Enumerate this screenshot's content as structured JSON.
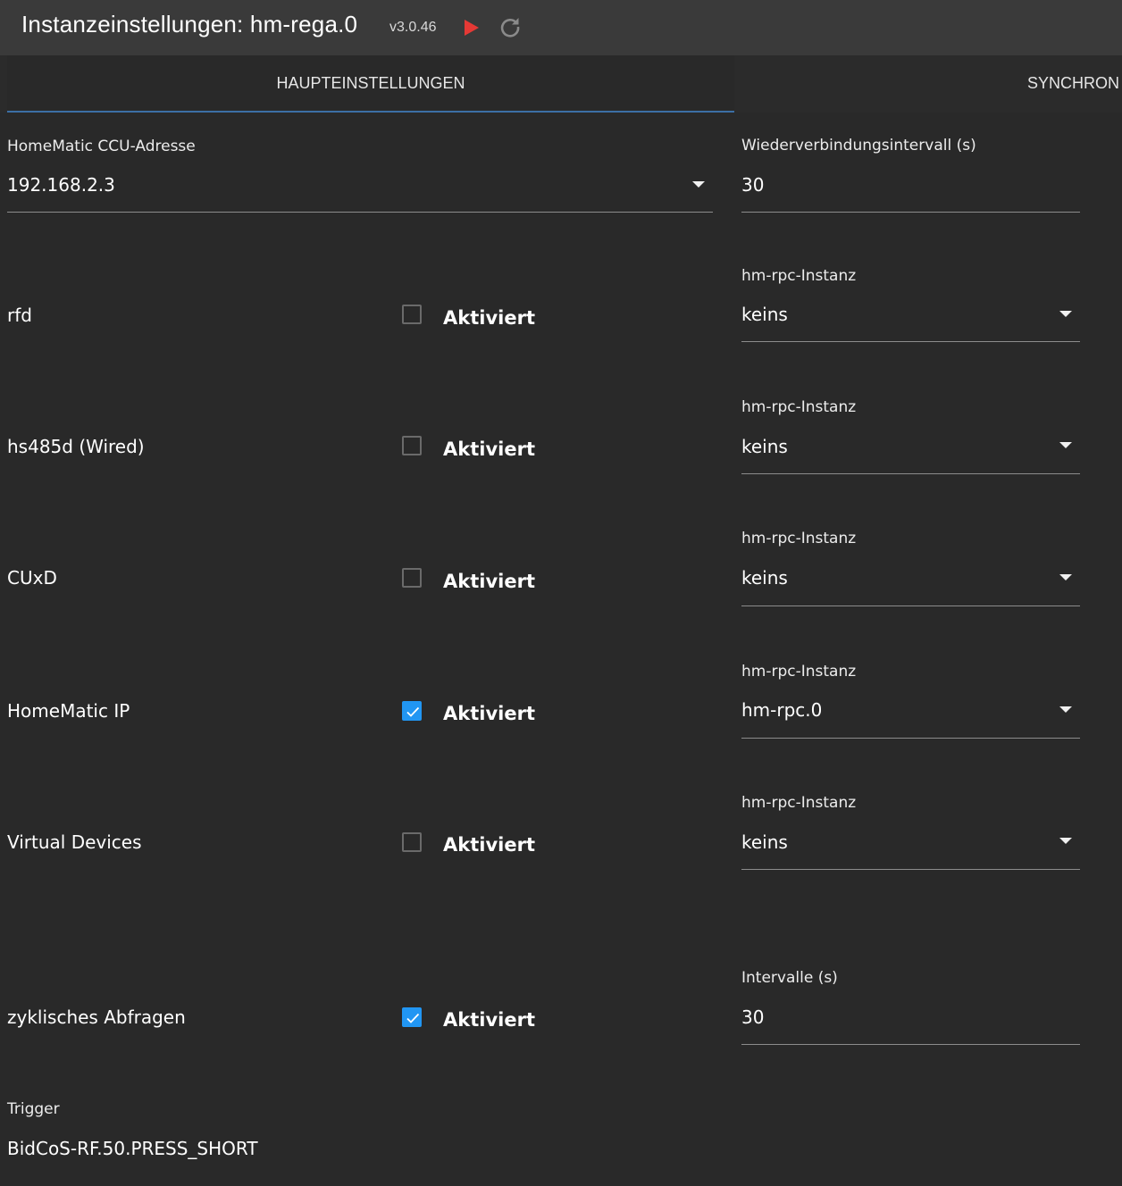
{
  "header": {
    "title": "Instanzeinstellungen: hm-rega.0",
    "version": "v3.0.46"
  },
  "tabs": [
    {
      "label": "HAUPTEINSTELLUNGEN"
    },
    {
      "label": "SYNCHRON"
    }
  ],
  "ccu": {
    "label": "HomeMatic CCU-Adresse",
    "value": "192.168.2.3"
  },
  "reconnect": {
    "label": "Wiederverbindungsintervall (s)",
    "value": "30"
  },
  "rows": [
    {
      "name": "rfd",
      "checkbox_label": "Aktiviert",
      "checked": false,
      "instance_label": "hm-rpc-Instanz",
      "instance_value": "keins"
    },
    {
      "name": "hs485d (Wired)",
      "checkbox_label": "Aktiviert",
      "checked": false,
      "instance_label": "hm-rpc-Instanz",
      "instance_value": "keins"
    },
    {
      "name": "CUxD",
      "checkbox_label": "Aktiviert",
      "checked": false,
      "instance_label": "hm-rpc-Instanz",
      "instance_value": "keins"
    },
    {
      "name": "HomeMatic IP",
      "checkbox_label": "Aktiviert",
      "checked": true,
      "instance_label": "hm-rpc-Instanz",
      "instance_value": "hm-rpc.0"
    },
    {
      "name": "Virtual Devices",
      "checkbox_label": "Aktiviert",
      "checked": false,
      "instance_label": "hm-rpc-Instanz",
      "instance_value": "keins"
    }
  ],
  "polling": {
    "name": "zyklisches Abfragen",
    "checkbox_label": "Aktiviert",
    "checked": true,
    "interval_label": "Intervalle (s)",
    "interval_value": "30"
  },
  "trigger": {
    "label": "Trigger",
    "value": "BidCoS-RF.50.PRESS_SHORT"
  },
  "colors": {
    "accent": "#2196f3",
    "play": "#e53935",
    "background": "#292929",
    "titlebar": "#3a3a3a"
  }
}
